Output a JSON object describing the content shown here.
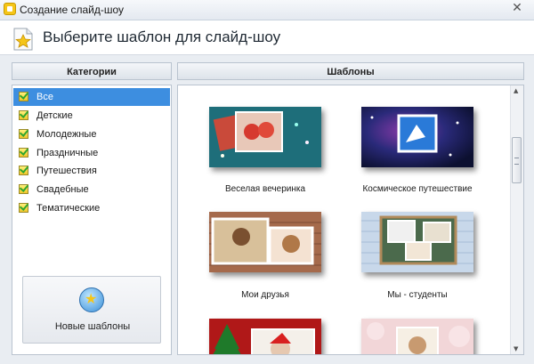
{
  "window": {
    "title": "Создание слайд-шоу",
    "close_glyph": "✕"
  },
  "header": {
    "title": "Выберите шаблон для слайд-шоу",
    "icon": "star-document-icon"
  },
  "categories": {
    "heading": "Категории",
    "items": [
      {
        "label": "Все",
        "selected": true
      },
      {
        "label": "Детские"
      },
      {
        "label": "Молодежные"
      },
      {
        "label": "Праздничные"
      },
      {
        "label": "Путешествия"
      },
      {
        "label": "Свадебные"
      },
      {
        "label": "Тематические"
      }
    ],
    "new_templates_button": "Новые шаблоны"
  },
  "templates": {
    "heading": "Шаблоны",
    "items": [
      {
        "name": "Веселая вечеринка",
        "bg": "#1e6e7a"
      },
      {
        "name": "Космическое путешествие",
        "bg": "#1a2a6a"
      },
      {
        "name": "Мои друзья",
        "bg": "#a56a4c"
      },
      {
        "name": "Мы - студенты",
        "bg": "#c8d8ea"
      },
      {
        "name": "",
        "bg": "#b01818"
      },
      {
        "name": "",
        "bg": "#f2d6d8"
      }
    ]
  },
  "colors": {
    "selection": "#3d8ee0",
    "accent": "#f5c518"
  }
}
